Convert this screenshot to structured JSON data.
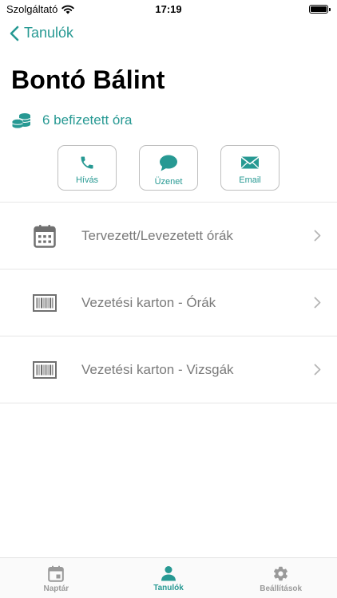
{
  "status_bar": {
    "carrier": "Szolgáltató",
    "time": "17:19"
  },
  "nav": {
    "back_label": "Tanulók"
  },
  "student": {
    "name": "Bontó Bálint",
    "paid_lessons": "6 befizetett óra"
  },
  "actions": [
    {
      "label": "Hívás",
      "icon": "phone-icon"
    },
    {
      "label": "Üzenet",
      "icon": "chat-bubble-icon"
    },
    {
      "label": "Email",
      "icon": "envelope-icon"
    }
  ],
  "menu": [
    {
      "label": "Tervezett/Levezetett órák",
      "icon": "calendar-icon"
    },
    {
      "label": "Vezetési karton - Órák",
      "icon": "barcode-icon"
    },
    {
      "label": "Vezetési karton - Vizsgák",
      "icon": "barcode-icon"
    }
  ],
  "tabs": [
    {
      "label": "Naptár",
      "icon": "calendar-icon",
      "active": false
    },
    {
      "label": "Tanulók",
      "icon": "person-icon",
      "active": true
    },
    {
      "label": "Beállítások",
      "icon": "gear-icon",
      "active": false
    }
  ],
  "colors": {
    "accent": "#279993",
    "muted": "#9a9a9a",
    "menu_text": "#7a7a7a"
  }
}
